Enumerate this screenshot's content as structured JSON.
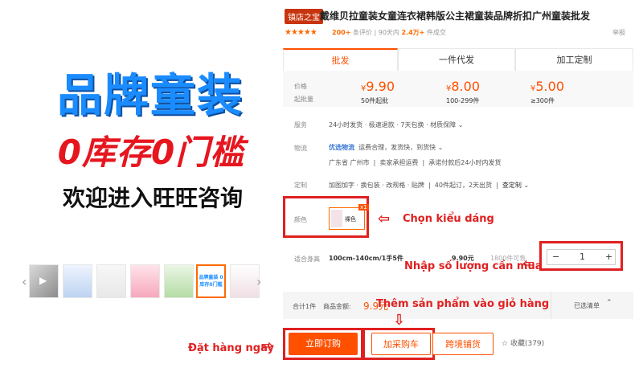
{
  "banner": {
    "brand": "品牌童装",
    "zero_stock": "0库存0门槛",
    "welcome": "欢迎进入旺旺咨询",
    "thumbnail_label": "品牌童装 0库存0门槛"
  },
  "product": {
    "store_badge": "镇店之宝",
    "title": "戴维贝拉童装女童连衣裙韩版公主裙童装品牌折扣广州童装批发",
    "stars": "★★★★★",
    "review_count": "200+",
    "review_label": "条评价",
    "sales_period": "90天内",
    "sales_count": "2.4万+",
    "sales_label": "件成交",
    "report": "举报"
  },
  "tabs": [
    "批发",
    "一件代发",
    "加工定制"
  ],
  "pricing": {
    "price_label": "价格",
    "moq_label": "起批量",
    "tiers": [
      {
        "price": "9.90",
        "qty": "50件起批"
      },
      {
        "price": "8.00",
        "qty": "100-299件"
      },
      {
        "price": "5.00",
        "qty": "≥300件"
      }
    ],
    "currency": "¥"
  },
  "service": {
    "label": "服务",
    "value": "24小时发货 · 极速退款 · 7天包换 · 材质保障"
  },
  "logistics": {
    "label": "物流",
    "tag": "优选物流",
    "value": "运费合理，发货快，到货快",
    "origin": "广东省 广州市",
    "buyer_pick": "卖家承担运费",
    "promise": "承诺付款后24小时内发货"
  },
  "custom": {
    "label": "定制",
    "value": "加图加字 · 换包装 · 改规格 · 贴牌",
    "moq": "40件起订，2天出货",
    "more": "查定制"
  },
  "color": {
    "label": "颜色",
    "swatch_label": "裸色",
    "badge": "x1"
  },
  "size": {
    "label": "适合身高",
    "value": "100cm-140cm/1手5件",
    "price": "9.90元",
    "stock": "1800件可售",
    "quantity": "1",
    "minus": "−",
    "plus": "+"
  },
  "summary": {
    "total": "合计1件",
    "amount_label": "商品金额:",
    "amount": "9.9元",
    "selected": "已选清单"
  },
  "buttons": {
    "order": "立即订购",
    "cart": "加采购车",
    "cross": "跨境铺货",
    "favorite": "收藏(379)"
  },
  "annotations": {
    "choose_style": "Chọn kiểu dáng",
    "enter_qty": "Nhập số lượng cần mua",
    "add_cart": "Thêm sản phẩm vào giỏ hàng",
    "order_now": "Đặt hàng ngay"
  },
  "colors": {
    "accent": "#ff5000",
    "annotation": "#e02020",
    "brand_blue": "#1a8cff"
  }
}
